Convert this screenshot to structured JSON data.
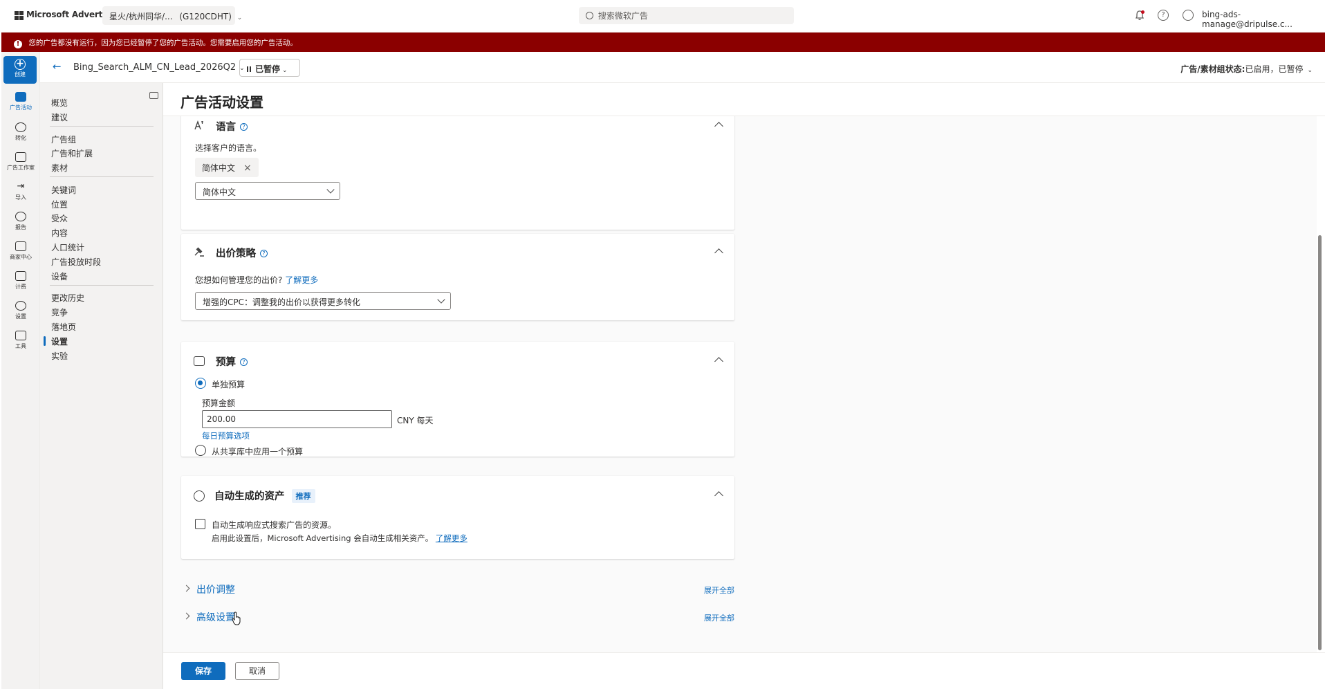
{
  "topbar": {
    "brand": "Microsoft Advertising",
    "account_name": "星火/杭州同华/...",
    "account_id": "(G120CDHT)",
    "search_placeholder": "搜索微软广告",
    "user_email": "bing-ads-manage@dripulse.c..."
  },
  "alert": {
    "message": "您的广告都没有运行，因为您已经暂停了您的广告活动。您需要启用您的广告活动。",
    "color": "#8b0000"
  },
  "rail": {
    "create_label": "创建",
    "items": [
      {
        "label": "广告活动",
        "icon": "megaphone-icon"
      },
      {
        "label": "转化",
        "icon": "target-icon"
      },
      {
        "label": "广告工作室",
        "icon": "edit-image-icon"
      },
      {
        "label": "导入",
        "icon": "import-arrow-icon"
      },
      {
        "label": "报告",
        "icon": "report-chart-icon"
      },
      {
        "label": "商家中心",
        "icon": "shopping-bag-icon"
      },
      {
        "label": "计费",
        "icon": "wallet-icon"
      },
      {
        "label": "设置",
        "icon": "gear-icon"
      },
      {
        "label": "工具",
        "icon": "tools-list-icon"
      }
    ]
  },
  "campaign": {
    "name": "Bing_Search_ALM_CN_Lead_2026Q2",
    "status": "已暂停",
    "ad_status_label": "广告/素材组状态:",
    "ad_status_value": "已启用，已暂停"
  },
  "subnav": {
    "items": [
      "概览",
      "建议",
      "广告组",
      "广告和扩展",
      "素材",
      "关键词",
      "位置",
      "受众",
      "内容",
      "人口统计",
      "广告投放时段",
      "设备",
      "更改历史",
      "竞争",
      "落地页",
      "设置",
      "实验"
    ],
    "selected": "设置"
  },
  "page": {
    "title": "广告活动设置"
  },
  "language": {
    "title": "语言",
    "prompt": "选择客户的语言。",
    "chip": "简体中文",
    "dropdown_value": "简体中文"
  },
  "bidding": {
    "title": "出价策略",
    "question": "您想如何管理您的出价?",
    "learn_more": "了解更多",
    "dropdown_value": "增强的CPC：调整我的出价以获得更多转化"
  },
  "budget": {
    "title": "预算",
    "option_individual": "单独预算",
    "amount_label": "预算金额",
    "amount_value": "200.00",
    "currency": "CNY",
    "period": "每天",
    "daily_options_link": "每日预算选项",
    "option_shared": "从共享库中应用一个预算"
  },
  "auto_assets": {
    "title": "自动生成的资产",
    "badge": "推荐",
    "checkbox_label": "自动生成响应式搜索广告的资源。",
    "description": "启用此设置后，Microsoft Advertising 会自动生成相关资产。",
    "learn_more": "了解更多"
  },
  "expanders": [
    {
      "title": "出价调整",
      "expand_all": "展开全部"
    },
    {
      "title": "高级设置",
      "expand_all": "展开全部"
    }
  ],
  "footer": {
    "save": "保存",
    "cancel": "取消"
  },
  "colors": {
    "accent": "#0f6cbd",
    "alert_bg": "#8b0000"
  }
}
